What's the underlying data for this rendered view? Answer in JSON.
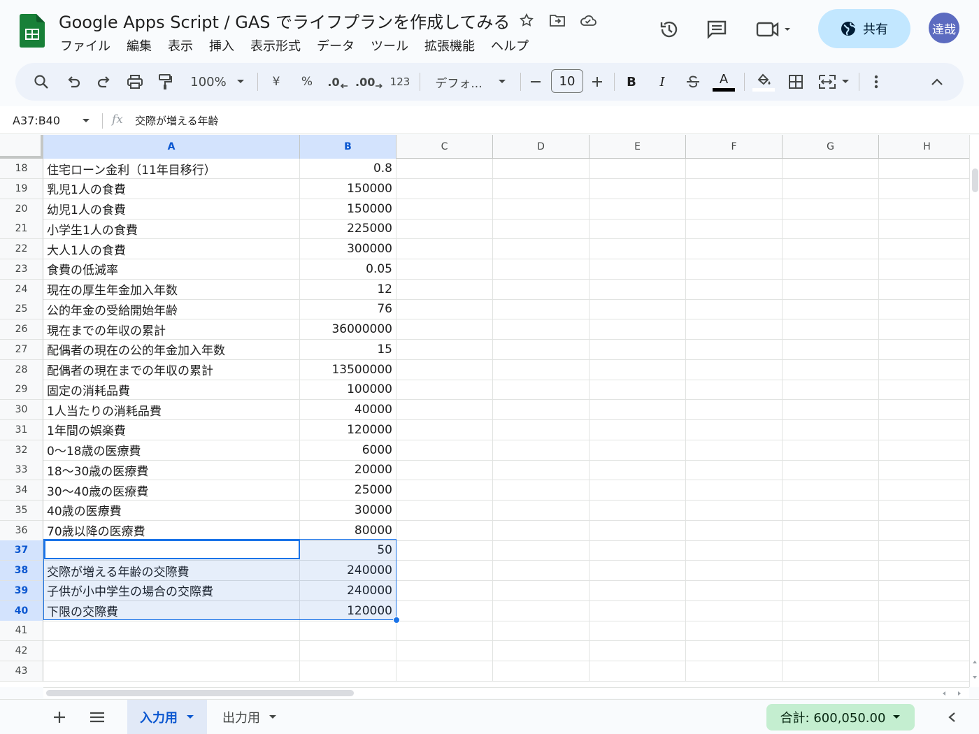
{
  "document": {
    "title": "Google Apps Script / GAS でライフプランを作成してみる"
  },
  "menu": [
    "ファイル",
    "編集",
    "表示",
    "挿入",
    "表示形式",
    "データ",
    "ツール",
    "拡張機能",
    "ヘルプ"
  ],
  "header": {
    "share_label": "共有",
    "avatar_text": "達哉"
  },
  "toolbar": {
    "zoom": "100%",
    "currency": "¥",
    "percent": "%",
    "decrease_decimal": ".0",
    "increase_decimal": ".00",
    "number_format": "123",
    "font": "デフォ...",
    "font_size": "10",
    "bold": "B",
    "italic": "I",
    "text_color_letter": "A"
  },
  "formula_bar": {
    "name_box": "A37:B40",
    "fx": "fx",
    "formula": "交際が増える年齢"
  },
  "columns": [
    "A",
    "B",
    "C",
    "D",
    "E",
    "F",
    "G",
    "H"
  ],
  "rows": [
    {
      "num": "18",
      "a": "住宅ローン金利（11年目移行）",
      "b": "0.8"
    },
    {
      "num": "19",
      "a": "乳児1人の食費",
      "b": "150000"
    },
    {
      "num": "20",
      "a": "幼児1人の食費",
      "b": "150000"
    },
    {
      "num": "21",
      "a": "小学生1人の食費",
      "b": "225000"
    },
    {
      "num": "22",
      "a": "大人1人の食費",
      "b": "300000"
    },
    {
      "num": "23",
      "a": "食費の低減率",
      "b": "0.05"
    },
    {
      "num": "24",
      "a": "現在の厚生年金加入年数",
      "b": "12"
    },
    {
      "num": "25",
      "a": "公的年金の受給開始年齢",
      "b": "76"
    },
    {
      "num": "26",
      "a": "現在までの年収の累計",
      "b": "36000000"
    },
    {
      "num": "27",
      "a": "配偶者の現在の公的年金加入年数",
      "b": "15"
    },
    {
      "num": "28",
      "a": "配偶者の現在までの年収の累計",
      "b": "13500000"
    },
    {
      "num": "29",
      "a": "固定の消耗品費",
      "b": "100000"
    },
    {
      "num": "30",
      "a": "1人当たりの消耗品費",
      "b": "40000"
    },
    {
      "num": "31",
      "a": "1年間の娯楽費",
      "b": "120000"
    },
    {
      "num": "32",
      "a": "0〜18歳の医療費",
      "b": "6000"
    },
    {
      "num": "33",
      "a": "18〜30歳の医療費",
      "b": "20000"
    },
    {
      "num": "34",
      "a": "30〜40歳の医療費",
      "b": "25000"
    },
    {
      "num": "35",
      "a": "40歳の医療費",
      "b": "30000"
    },
    {
      "num": "36",
      "a": "70歳以降の医療費",
      "b": "80000"
    },
    {
      "num": "37",
      "a": "交際が増える年齢",
      "b": "50"
    },
    {
      "num": "38",
      "a": "交際が増える年齢の交際費",
      "b": "240000"
    },
    {
      "num": "39",
      "a": "子供が小中学生の場合の交際費",
      "b": "240000"
    },
    {
      "num": "40",
      "a": "下限の交際費",
      "b": "120000"
    },
    {
      "num": "41",
      "a": "",
      "b": ""
    },
    {
      "num": "42",
      "a": "",
      "b": ""
    },
    {
      "num": "43",
      "a": "",
      "b": ""
    }
  ],
  "sheets": {
    "tabs": [
      "入力用",
      "出力用"
    ]
  },
  "status": {
    "sum": "合計: 600,050.00"
  },
  "colors": {
    "accent": "#0b57d0",
    "selection": "#1a73e8",
    "share_bg": "#c2e7ff",
    "sum_bg": "#c4eed0",
    "sheets_green": "#188038"
  }
}
